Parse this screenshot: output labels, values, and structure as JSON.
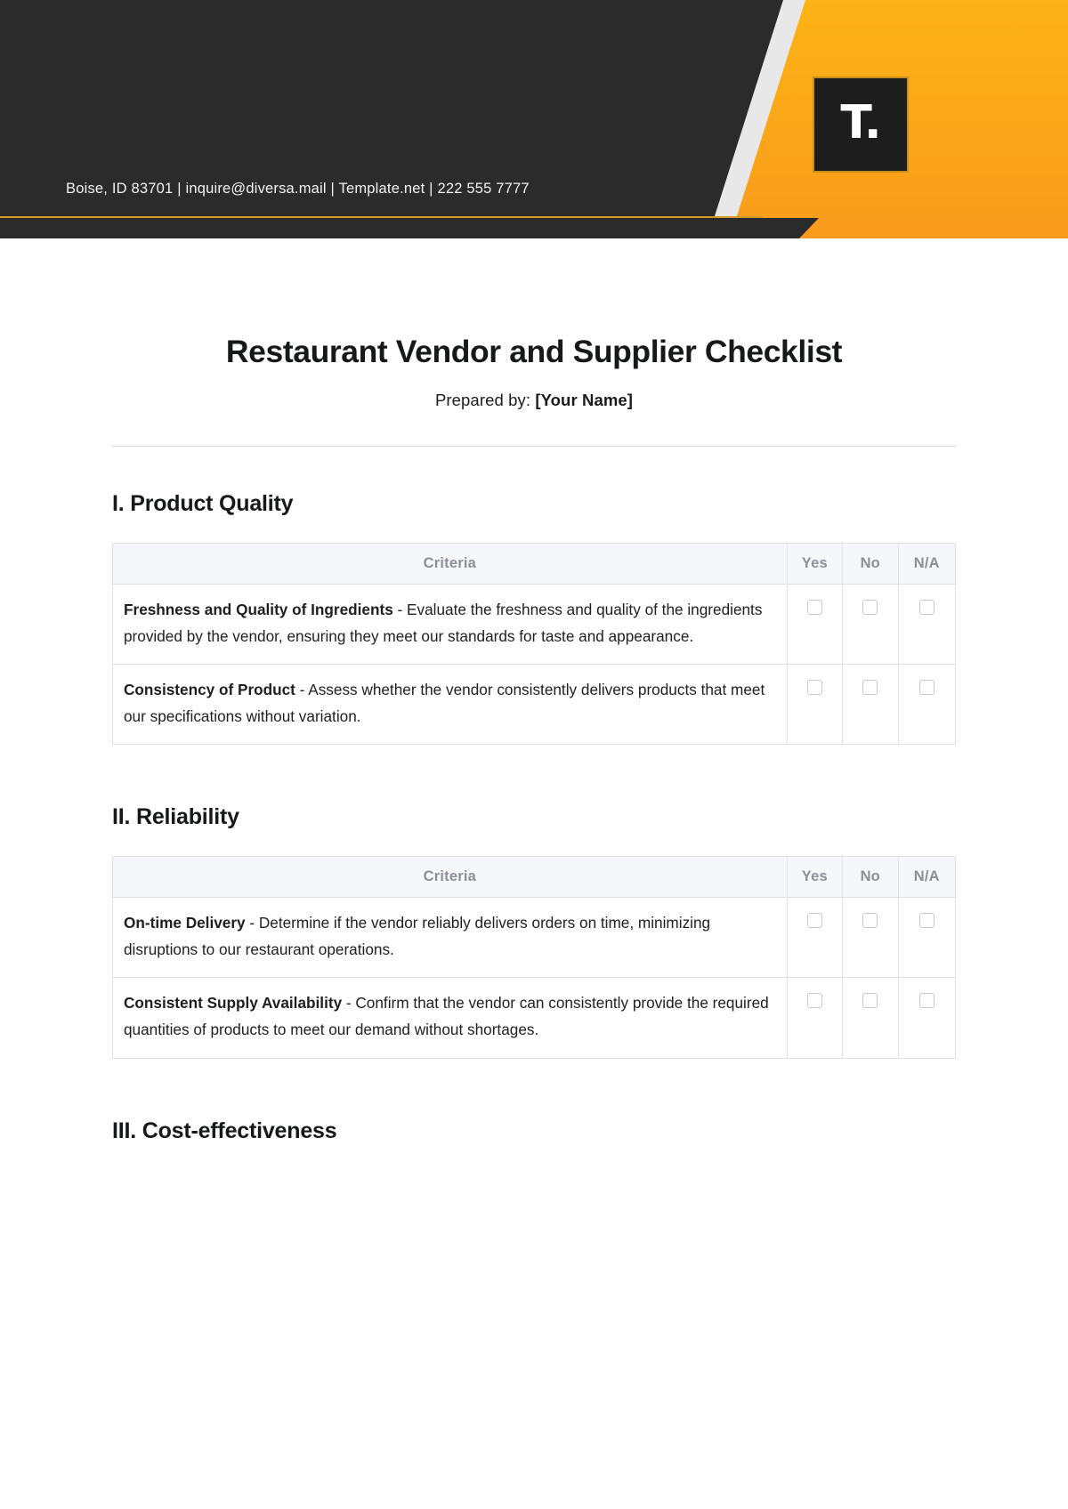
{
  "header": {
    "contact_line": "Boise, ID 83701 | inquire@diversa.mail | Template.net | 222 555 7777",
    "logo_text": "T.",
    "colors": {
      "orange": "#f99b1c",
      "dark": "#2b2b2b",
      "gold_rule": "#d39a2a"
    }
  },
  "document": {
    "title": "Restaurant Vendor and Supplier Checklist",
    "prepared_label": "Prepared by:",
    "prepared_value": "[Your Name]"
  },
  "table_headers": {
    "criteria": "Criteria",
    "yes": "Yes",
    "no": "No",
    "na": "N/A"
  },
  "sections": [
    {
      "heading": "I. Product Quality",
      "rows": [
        {
          "term": "Freshness and Quality of Ingredients",
          "description": " - Evaluate the freshness and quality of the ingredients provided by the vendor, ensuring they meet our standards for taste and appearance."
        },
        {
          "term": "Consistency of Product",
          "description": " - Assess whether the vendor consistently delivers products that meet our specifications without variation."
        }
      ]
    },
    {
      "heading": "II. Reliability",
      "rows": [
        {
          "term": "On-time Delivery",
          "description": " - Determine if the vendor reliably delivers orders on time, minimizing disruptions to our restaurant operations."
        },
        {
          "term": "Consistent Supply Availability",
          "description": " - Confirm that the vendor can consistently provide the required quantities of products to meet our demand without shortages."
        }
      ]
    },
    {
      "heading": "III. Cost-effectiveness",
      "rows": []
    }
  ]
}
